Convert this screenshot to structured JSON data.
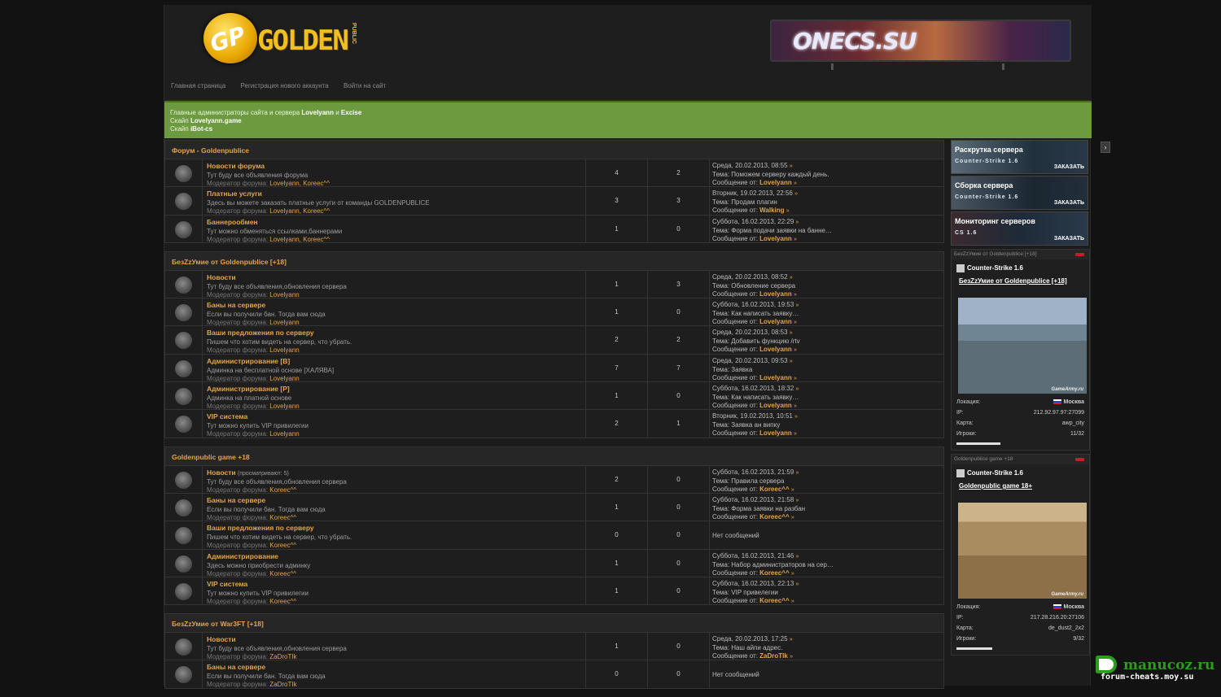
{
  "header": {
    "logo": {
      "mark": "GP",
      "word": "GOLDEN",
      "sub": "PUBLIC"
    },
    "banner": {
      "text": "ONECS.SU"
    },
    "nav": [
      "Главная страница",
      "Регистрация нового аккаунта",
      "Войти на сайт"
    ]
  },
  "announce": {
    "line1_pre": "Главные администраторы сайта и сервера",
    "admin1": "Lovelyann",
    "and": "и",
    "admin2": "Excise",
    "line2_pre": "Скайп",
    "skype1": "Lovelyann.game",
    "line3_pre": "Скайп",
    "skype2": "iBot-cs"
  },
  "categories": [
    {
      "title": "Форум - Goldenpublice",
      "forums": [
        {
          "title": "Новости форума",
          "viewing": "",
          "desc": "Тут буду все объявления форума",
          "mod_label": "Модератор форума:",
          "mods": "Lovelyann, Koreec^^",
          "topics": "4",
          "posts": "2",
          "last_date": "Среда, 20.02.2013, 08:55",
          "last_topic": "Тема: Поможем серверу каждый день.",
          "last_author_label": "Сообщение от:",
          "last_author": "Lovelyann",
          "empty": ""
        },
        {
          "title": "Платные услуги",
          "viewing": "",
          "desc": "Здесь вы можете заказать платные услуги от команды GOLDENPUBLICE",
          "mod_label": "Модератор форума:",
          "mods": "Lovelyann, Koreec^^",
          "topics": "3",
          "posts": "3",
          "last_date": "Вторник, 19.02.2013, 22:56",
          "last_topic": "Тема: Продам плагин",
          "last_author_label": "Сообщение от:",
          "last_author": "Walking",
          "empty": ""
        },
        {
          "title": "Баннерообмен",
          "viewing": "",
          "desc": "Тут можно обменяться ссылками,баннерами",
          "mod_label": "Модератор форума:",
          "mods": "Lovelyann, Koreec^^",
          "topics": "1",
          "posts": "0",
          "last_date": "Суббота, 16.02.2013, 22:29",
          "last_topic": "Тема: Форма подачи заявки на банне…",
          "last_author_label": "Сообщение от:",
          "last_author": "Lovelyann",
          "empty": ""
        }
      ]
    },
    {
      "title": "БезZzУмие от Goldenpublice [+18]",
      "forums": [
        {
          "title": "Новости",
          "viewing": "",
          "desc": "Тут буду все объявления,обновления сервера",
          "mod_label": "Модератор форума:",
          "mods": "Lovelyann",
          "topics": "1",
          "posts": "3",
          "last_date": "Среда, 20.02.2013, 08:52",
          "last_topic": "Тема: Обновление сервера",
          "last_author_label": "Сообщение от:",
          "last_author": "Lovelyann",
          "empty": ""
        },
        {
          "title": "Баны на сервере",
          "viewing": "",
          "desc": "Если вы получили бан. Тогда вам сюда",
          "mod_label": "Модератор форума:",
          "mods": "Lovelyann",
          "topics": "1",
          "posts": "0",
          "last_date": "Суббота, 16.02.2013, 19:53",
          "last_topic": "Тема: Как написать заявку…",
          "last_author_label": "Сообщение от:",
          "last_author": "Lovelyann",
          "empty": ""
        },
        {
          "title": "Ваши предложения по серверу",
          "viewing": "",
          "desc": "Пишем что хотим видеть на сервер, что убрать.",
          "mod_label": "Модератор форума:",
          "mods": "Lovelyann",
          "topics": "2",
          "posts": "2",
          "last_date": "Среда, 20.02.2013, 08:53",
          "last_topic": "Тема: Добавить функцию /rtv",
          "last_author_label": "Сообщение от:",
          "last_author": "Lovelyann",
          "empty": ""
        },
        {
          "title": "Администрирование [В]",
          "viewing": "",
          "desc": "Админка на бесплатной основе [ХАЛЯВА]",
          "mod_label": "Модератор форума:",
          "mods": "Lovelyann",
          "topics": "7",
          "posts": "7",
          "last_date": "Среда, 20.02.2013, 09:53",
          "last_topic": "Тема: Заявка",
          "last_author_label": "Сообщение от:",
          "last_author": "Lovelyann",
          "empty": ""
        },
        {
          "title": "Администрирование [P]",
          "viewing": "",
          "desc": "Админка на платной основе",
          "mod_label": "Модератор форума:",
          "mods": "Lovelyann",
          "topics": "1",
          "posts": "0",
          "last_date": "Суббота, 16.02.2013, 18:32",
          "last_topic": "Тема: Как написать заявку…",
          "last_author_label": "Сообщение от:",
          "last_author": "Lovelyann",
          "empty": ""
        },
        {
          "title": "VIP система",
          "viewing": "",
          "desc": "Тут можно купить VIP привилегии",
          "mod_label": "Модератор форума:",
          "mods": "Lovelyann",
          "topics": "2",
          "posts": "1",
          "last_date": "Вторник, 19.02.2013, 10:51",
          "last_topic": "Тема: Заявка ан випку",
          "last_author_label": "Сообщение от:",
          "last_author": "Lovelyann",
          "empty": ""
        }
      ]
    },
    {
      "title": "Goldenpublic game +18",
      "forums": [
        {
          "title": "Новости",
          "viewing": "(просматривают: 5)",
          "desc": "Тут буду все объявления,обновления сервера",
          "mod_label": "Модератор форума:",
          "mods": "Koreec^^",
          "topics": "2",
          "posts": "0",
          "last_date": "Суббота, 16.02.2013, 21:59",
          "last_topic": "Тема: Правила сервера",
          "last_author_label": "Сообщение от:",
          "last_author": "Koreec^^",
          "empty": ""
        },
        {
          "title": "Баны на сервере",
          "viewing": "",
          "desc": "Если вы получили бан. Тогда вам сюда",
          "mod_label": "Модератор форума:",
          "mods": "Koreec^^",
          "topics": "1",
          "posts": "0",
          "last_date": "Суббота, 16.02.2013, 21:58",
          "last_topic": "Тема: Форма заявки на разбан",
          "last_author_label": "Сообщение от:",
          "last_author": "Koreec^^",
          "empty": ""
        },
        {
          "title": "Ваши предложения по серверу",
          "viewing": "",
          "desc": "Пишем что хотим видеть на сервер, что убрать.",
          "mod_label": "Модератор форума:",
          "mods": "Koreec^^",
          "topics": "0",
          "posts": "0",
          "last_date": "",
          "last_topic": "",
          "last_author_label": "",
          "last_author": "",
          "empty": "Нет сообщений"
        },
        {
          "title": "Администрирование",
          "viewing": "",
          "desc": "Здесь можно приобрести админку",
          "mod_label": "Модератор форума:",
          "mods": "Koreec^^",
          "topics": "1",
          "posts": "0",
          "last_date": "Суббота, 16.02.2013, 21:46",
          "last_topic": "Тема: Набор администраторов на сер…",
          "last_author_label": "Сообщение от:",
          "last_author": "Koreec^^",
          "empty": ""
        },
        {
          "title": "VIP система",
          "viewing": "",
          "desc": "Тут можно купить VIP привилегии",
          "mod_label": "Модератор форума:",
          "mods": "Koreec^^",
          "topics": "1",
          "posts": "0",
          "last_date": "Суббота, 16.02.2013, 22:13",
          "last_topic": "Тема: VIP привелегии",
          "last_author_label": "Сообщение от:",
          "last_author": "Koreec^^",
          "empty": ""
        }
      ]
    },
    {
      "title": "БезZzУмие от War3FT [+18]",
      "forums": [
        {
          "title": "Новости",
          "viewing": "",
          "desc": "Тут буду все объявления,обновления сервера",
          "mod_label": "Модератор форума:",
          "mods": "ZaDroTIk",
          "topics": "1",
          "posts": "0",
          "last_date": "Среда, 20.02.2013, 17:25",
          "last_topic": "Тема: Наш айпи адрес.",
          "last_author_label": "Сообщение от:",
          "last_author": "ZaDroTIk",
          "empty": ""
        },
        {
          "title": "Баны на сервере",
          "viewing": "",
          "desc": "Если вы получили бан. Тогда вам сюда",
          "mod_label": "Модератор форума:",
          "mods": "ZaDroTIk",
          "topics": "0",
          "posts": "0",
          "last_date": "",
          "last_topic": "",
          "last_author_label": "",
          "last_author": "",
          "empty": "Нет сообщений"
        }
      ]
    }
  ],
  "sidebar": {
    "ads": [
      {
        "a": "Раскрутка сервера",
        "b": "Counter-Strike 1.6",
        "c": "ЗАКАЗАТЬ"
      },
      {
        "a": "Сборка сервера",
        "b": "Counter-Strike 1.6",
        "c": "ЗАКАЗАТЬ"
      },
      {
        "a": "Мониторинг серверов",
        "b": "CS 1.6",
        "c": "ЗАКАЗАТЬ"
      }
    ],
    "monitors": [
      {
        "header": "БезZzУмие от Goldenpublice [+18]",
        "game": "Counter-Strike 1.6",
        "name": "БезZzУмие от Goldenpublice [+18]",
        "watermark": "GameArmy.ru",
        "loc_label": "Локация:",
        "loc": "Москва",
        "ip_label": "IP:",
        "ip": "212.92.97.97:27099",
        "map_label": "Карта:",
        "map": "awp_city",
        "players_label": "Игроки:",
        "players": "11/32",
        "fill": 0.34
      },
      {
        "header": "Goldenpublice game +18",
        "game": "Counter-Strike 1.6",
        "name": "Goldenpublic game 18+",
        "watermark": "GameArmy.ru",
        "loc_label": "Локация:",
        "loc": "Москва",
        "ip_label": "IP:",
        "ip": "217.28.216.20:27106",
        "map_label": "Карта:",
        "map": "de_dust2_2x2",
        "players_label": "Игроки:",
        "players": "9/32",
        "fill": 0.28
      }
    ]
  },
  "watermark": {
    "line1": "manucoz.ru",
    "line2": "forum-cheats.moy.su"
  },
  "colors": {
    "accent": "#e3a44a",
    "announce_bg": "#6d9a3e",
    "page_bg": "#1c1c1c"
  }
}
